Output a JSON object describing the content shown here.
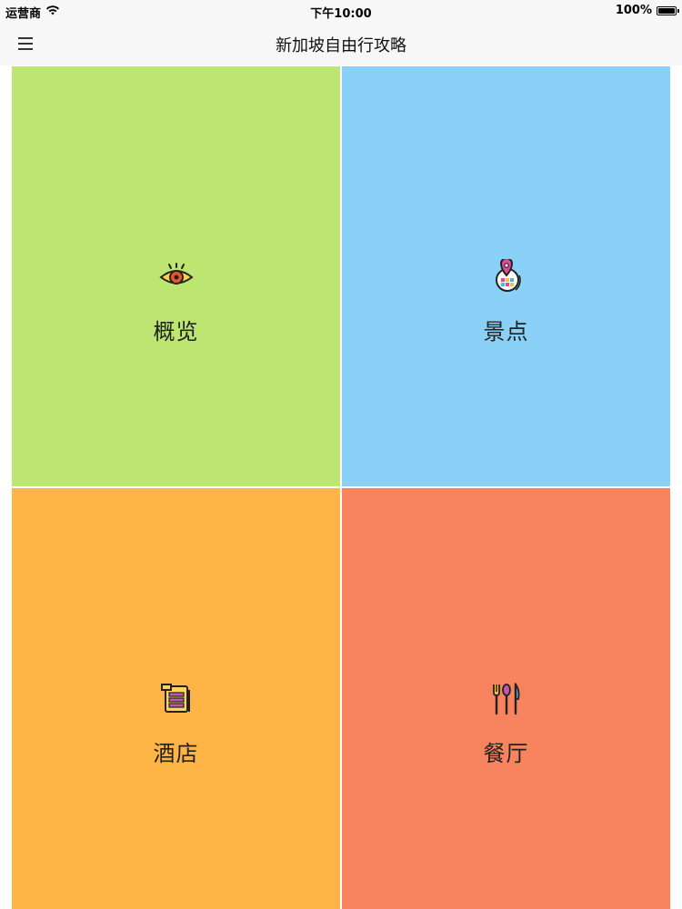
{
  "status": {
    "carrier": "运营商",
    "time": "下午10:00",
    "battery": "100%",
    "battery_level": 1.0
  },
  "nav": {
    "title": "新加坡自由行攻略",
    "menu_icon": "hamburger-menu-icon"
  },
  "tiles": [
    {
      "label": "概览",
      "icon": "eye-icon",
      "color": "#bde572"
    },
    {
      "label": "景点",
      "icon": "globe-pin-icon",
      "color": "#8ad0f7"
    },
    {
      "label": "酒店",
      "icon": "hotel-building-icon",
      "color": "#ffb446"
    },
    {
      "label": "餐厅",
      "icon": "cutlery-icon",
      "color": "#f8845f"
    }
  ]
}
